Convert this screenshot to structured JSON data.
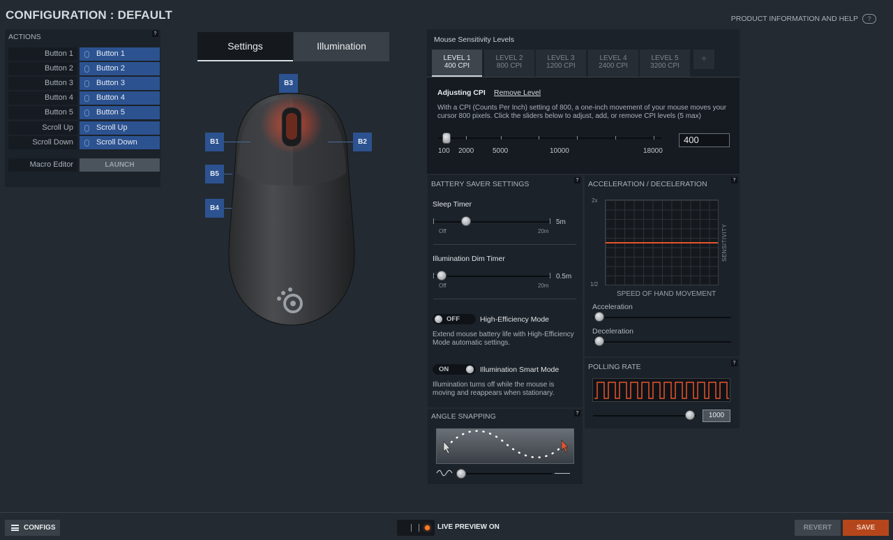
{
  "header": {
    "title": "CONFIGURATION : DEFAULT",
    "help_link": "PRODUCT INFORMATION AND HELP"
  },
  "actions": {
    "title": "ACTIONS",
    "rows": [
      {
        "label": "Button 1",
        "value": "Button 1"
      },
      {
        "label": "Button 2",
        "value": "Button 2"
      },
      {
        "label": "Button 3",
        "value": "Button 3"
      },
      {
        "label": "Button 4",
        "value": "Button 4"
      },
      {
        "label": "Button 5",
        "value": "Button 5"
      },
      {
        "label": "Scroll Up",
        "value": "Scroll Up"
      },
      {
        "label": "Scroll Down",
        "value": "Scroll Down"
      }
    ],
    "macro_label": "Macro Editor",
    "launch_label": "LAUNCH"
  },
  "tabs": {
    "settings": "Settings",
    "illumination": "Illumination"
  },
  "mouse_buttons": {
    "b1": "B1",
    "b2": "B2",
    "b3": "B3",
    "b4": "B4",
    "b5": "B5"
  },
  "sensitivity": {
    "title": "Mouse Sensitivity Levels",
    "levels": [
      {
        "name": "LEVEL 1",
        "cpi": "400 CPI"
      },
      {
        "name": "LEVEL 2",
        "cpi": "800 CPI"
      },
      {
        "name": "LEVEL 3",
        "cpi": "1200 CPI"
      },
      {
        "name": "LEVEL 4",
        "cpi": "2400 CPI"
      },
      {
        "name": "LEVEL 5",
        "cpi": "3200 CPI"
      }
    ],
    "add_label": "+",
    "adjusting": "Adjusting CPI",
    "remove": "Remove Level",
    "description": "With a CPI (Counts Per Inch) setting of 800, a one-inch movement of your mouse moves your cursor 800 pixels. Click the sliders below to adjust, add, or remove CPI levels (5 max)",
    "ticks": [
      "100",
      "2000",
      "5000",
      "10000",
      "18000"
    ],
    "value": "400"
  },
  "battery": {
    "title": "BATTERY SAVER SETTINGS",
    "sleep_label": "Sleep Timer",
    "sleep_value": "5m",
    "dim_label": "Illumination Dim Timer",
    "dim_value": "0.5m",
    "off": "Off",
    "max": "20m",
    "efficiency_toggle": "OFF",
    "efficiency_label": "High-Efficiency Mode",
    "efficiency_desc": "Extend mouse battery life with High-Efficiency Mode automatic settings.",
    "smart_toggle": "ON",
    "smart_label": "Illumination Smart Mode",
    "smart_desc": "Illumination turns off while the mouse is moving and reappears when stationary."
  },
  "accel": {
    "title": "ACCELERATION / DECELERATION",
    "y_top": "2x",
    "y_bottom": "1/2",
    "y_label": "SENSITIVITY",
    "x_label": "SPEED OF HAND MOVEMENT",
    "acceleration": "Acceleration",
    "deceleration": "Deceleration"
  },
  "polling": {
    "title": "POLLING RATE",
    "value": "1000"
  },
  "angle": {
    "title": "ANGLE SNAPPING"
  },
  "bottom": {
    "configs": "CONFIGS",
    "live_preview": "LIVE PREVIEW ON",
    "revert": "REVERT",
    "save": "SAVE"
  },
  "colors": {
    "accent": "#2c5290",
    "save": "#b5461b",
    "curve": "#e8542a"
  }
}
